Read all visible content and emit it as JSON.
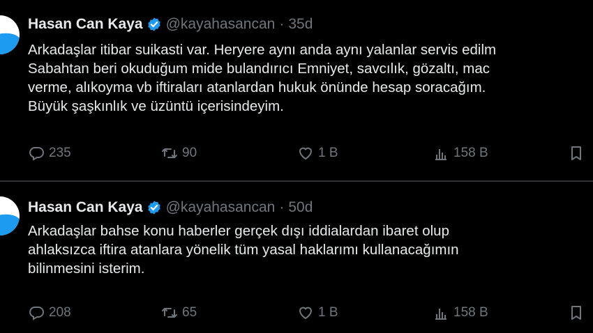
{
  "tweets": [
    {
      "author": {
        "name": "Hasan Can Kaya",
        "handle": "@kayahasancan",
        "verified": true
      },
      "time": "35d",
      "lines": [
        "Arkadaşlar itibar suikasti var. Heryere aynı anda aynı yalanlar servis edilm",
        "Sabahtan beri okuduğum mide bulandırıcı Emniyet, savcılık, gözaltı, mac",
        "verme, alıkoyma vb iftiraları atanlardan hukuk önünde hesap soracağım.",
        "Büyük şaşkınlık ve üzüntü içerisindeyim."
      ],
      "stats": {
        "replies": "235",
        "retweets": "90",
        "likes": "1 B",
        "views": "158 B"
      }
    },
    {
      "author": {
        "name": "Hasan Can Kaya",
        "handle": "@kayahasancan",
        "verified": true
      },
      "time": "50d",
      "lines": [
        "Arkadaşlar bahse konu haberler gerçek dışı iddialardan ibaret olup",
        "ahlaksızca iftira atanlara yönelik tüm yasal haklarımı kullanacağımın",
        "bilinmesini isterim."
      ],
      "stats": {
        "replies": "208",
        "retweets": "65",
        "likes": "1 B",
        "views": "158 B"
      }
    }
  ],
  "colors": {
    "background": "#000000",
    "text": "#e7e9ea",
    "muted": "#71767b",
    "verified": "#1d9bf0",
    "divider": "#2f3336"
  },
  "icons": [
    "reply-icon",
    "retweet-icon",
    "like-icon",
    "views-icon",
    "bookmark-icon",
    "verified-badge-icon"
  ]
}
